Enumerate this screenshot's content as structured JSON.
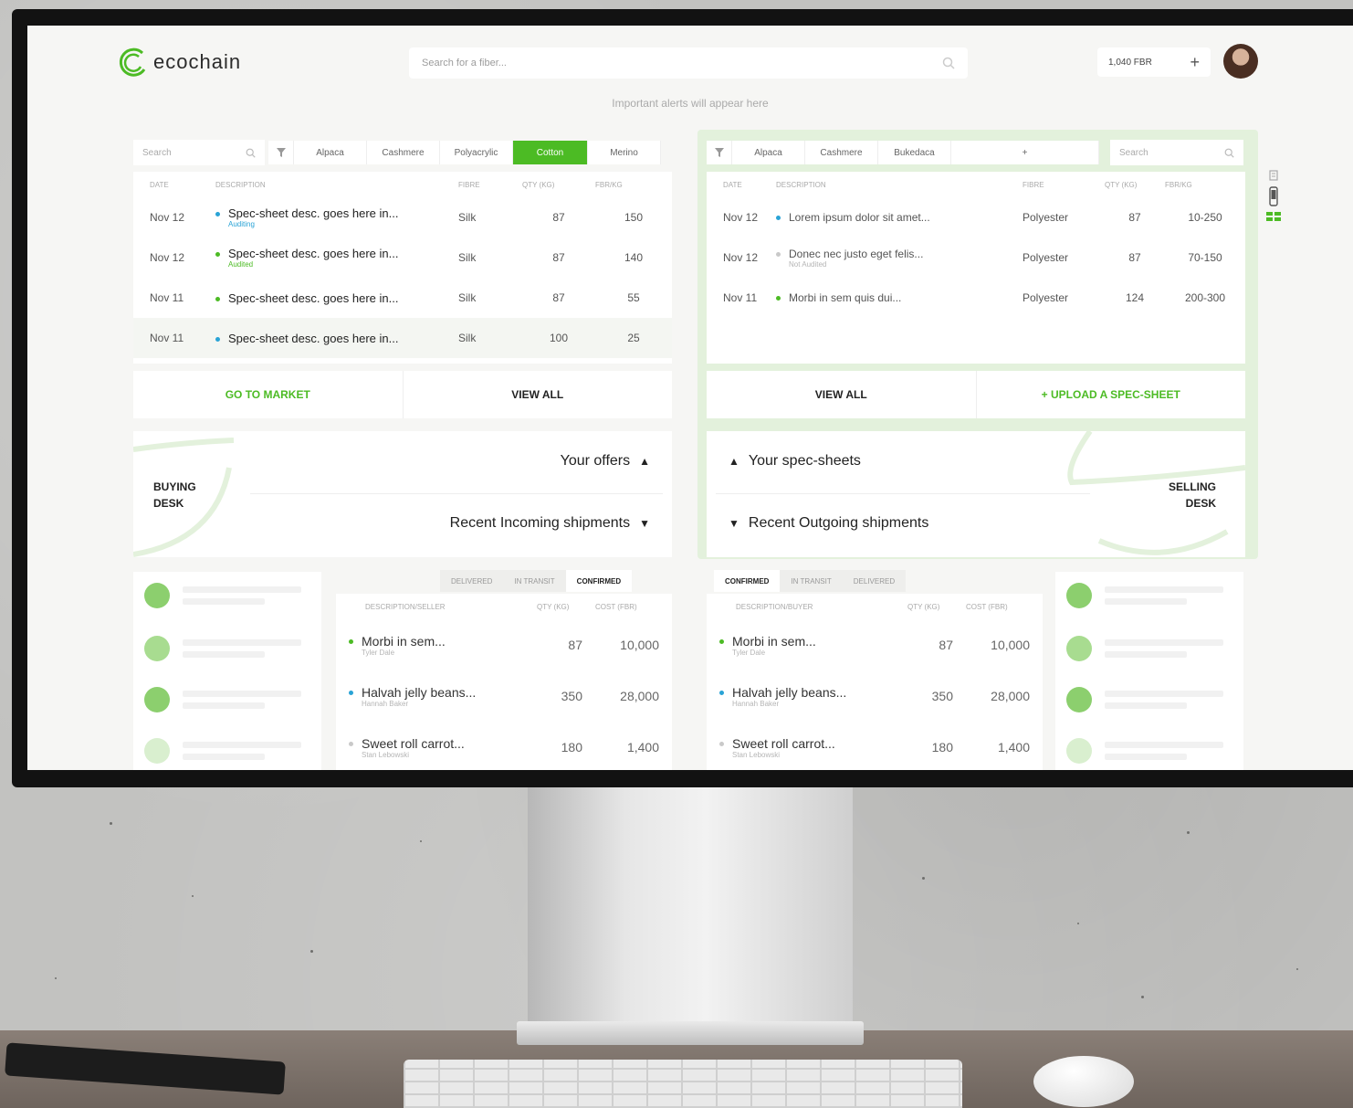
{
  "header": {
    "brand": "ecochain",
    "search_placeholder": "Search for a fiber...",
    "balance": "1,040 FBR",
    "balance_add": "+",
    "alerts": "Important alerts will appear here"
  },
  "buying": {
    "search_placeholder": "Search",
    "chips": [
      "Alpaca",
      "Cashmere",
      "Polyacrylic",
      "Cotton",
      "Merino"
    ],
    "active_chip": "Cotton",
    "columns": [
      "Date",
      "Description",
      "Fibre",
      "QTY (KG)",
      "FBR/KG"
    ],
    "rows": [
      {
        "date": "Nov 12",
        "desc": "Spec-sheet desc. goes here in...",
        "status": "Auditing",
        "fibre": "Silk",
        "qty": "87",
        "price": "150"
      },
      {
        "date": "Nov 12",
        "desc": "Spec-sheet desc. goes here in...",
        "status": "Audited",
        "fibre": "Silk",
        "qty": "87",
        "price": "140"
      },
      {
        "date": "Nov 11",
        "desc": "Spec-sheet desc. goes here in...",
        "status": "",
        "fibre": "Silk",
        "qty": "87",
        "price": "55"
      },
      {
        "date": "Nov 11",
        "desc": "Spec-sheet desc. goes here in...",
        "status": "",
        "fibre": "Silk",
        "qty": "100",
        "price": "25"
      }
    ],
    "go_market": "GO TO MARKET",
    "view_all": "VIEW ALL",
    "desk_label": [
      "BUYING",
      "DESK"
    ],
    "offers": "Your offers",
    "shipments": "Recent Incoming shipments",
    "ship_tabs": [
      "Delivered",
      "In transit",
      "Confirmed"
    ],
    "ship_columns": [
      "Description/Seller",
      "QTY (KG)",
      "Cost (FBR)"
    ],
    "ship_rows": [
      {
        "desc": "Morbi in sem...",
        "who": "Tyler Dale",
        "qty": "87",
        "cost": "10,000"
      },
      {
        "desc": "Halvah jelly beans...",
        "who": "Hannah Baker",
        "qty": "350",
        "cost": "28,000"
      },
      {
        "desc": "Sweet roll carrot...",
        "who": "Stan Lebowski",
        "qty": "180",
        "cost": "1,400"
      }
    ]
  },
  "selling": {
    "search_placeholder": "Search",
    "chips": [
      "Alpaca",
      "Cashmere",
      "Bukedaca",
      "+"
    ],
    "columns": [
      "Date",
      "Description",
      "Fibre",
      "QTY (KG)",
      "FBR/KG"
    ],
    "rows": [
      {
        "date": "Nov 12",
        "desc": "Lorem ipsum dolor sit amet...",
        "status": "",
        "fibre": "Polyester",
        "qty": "87",
        "price": "10-250"
      },
      {
        "date": "Nov 12",
        "desc": "Donec nec justo eget felis...",
        "status": "Not Audited",
        "fibre": "Polyester",
        "qty": "87",
        "price": "70-150"
      },
      {
        "date": "Nov 11",
        "desc": "Morbi in sem quis dui...",
        "status": "",
        "fibre": "Polyester",
        "qty": "124",
        "price": "200-300"
      }
    ],
    "view_all": "VIEW ALL",
    "upload": "+ UPLOAD A SPEC-SHEET",
    "desk_label": [
      "SELLING",
      "DESK"
    ],
    "specsheets": "Your spec-sheets",
    "shipments": "Recent Outgoing shipments",
    "ship_tabs": [
      "Confirmed",
      "In transit",
      "Delivered"
    ],
    "ship_columns": [
      "Description/Buyer",
      "QTY (KG)",
      "Cost (FBR)"
    ],
    "ship_rows": [
      {
        "desc": "Morbi in sem...",
        "who": "Tyler Dale",
        "qty": "87",
        "cost": "10,000"
      },
      {
        "desc": "Halvah jelly beans...",
        "who": "Hannah Baker",
        "qty": "350",
        "cost": "28,000"
      },
      {
        "desc": "Sweet roll carrot...",
        "who": "Stan Lebowski",
        "qty": "180",
        "cost": "1,400"
      }
    ]
  },
  "colors": {
    "accent": "#4cbb24",
    "info": "#29a3d6",
    "frame": "#e3f1dc"
  },
  "icons": [
    "search-icon",
    "filter-icon",
    "plus-icon",
    "chevron-up-icon",
    "chevron-down-icon",
    "document-icon",
    "phone-icon",
    "grid-icon"
  ]
}
